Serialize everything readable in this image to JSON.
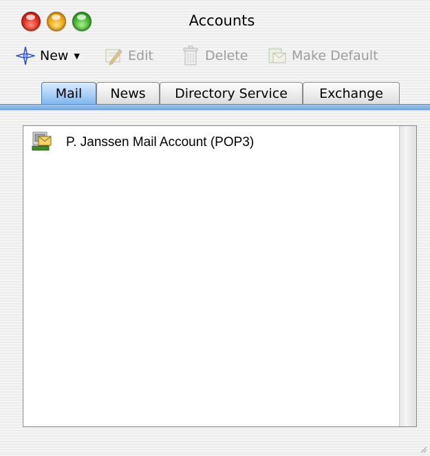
{
  "window": {
    "title": "Accounts"
  },
  "toolbar": {
    "new_label": "New",
    "edit_label": "Edit",
    "delete_label": "Delete",
    "make_default_label": "Make Default"
  },
  "tabs": [
    {
      "label": "Mail",
      "active": true
    },
    {
      "label": "News",
      "active": false
    },
    {
      "label": "Directory Service",
      "active": false
    },
    {
      "label": "Exchange",
      "active": false
    }
  ],
  "accounts": [
    {
      "label": "P. Janssen Mail Account (POP3)",
      "icon": "mail-account-icon"
    }
  ],
  "colors": {
    "tab_accent": "#7fb6ef",
    "disabled_text": "#9c9c9c"
  }
}
